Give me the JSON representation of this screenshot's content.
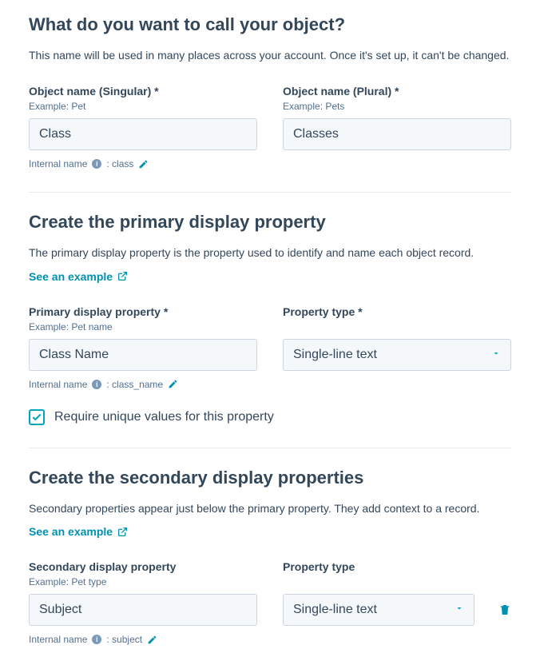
{
  "section1": {
    "title": "What do you want to call your object?",
    "desc": "This name will be used in many places across your account. Once it's set up, it can't be changed.",
    "singular": {
      "label": "Object name (Singular) *",
      "example": "Example: Pet",
      "value": "Class",
      "internal_label": "Internal name",
      "internal_value": ": class"
    },
    "plural": {
      "label": "Object name (Plural) *",
      "example": "Example: Pets",
      "value": "Classes"
    }
  },
  "section2": {
    "title": "Create the primary display property",
    "desc": "The primary display property is the property used to identify and name each object record.",
    "link": "See an example",
    "primary": {
      "label": "Primary display property *",
      "example": "Example: Pet name",
      "value": "Class Name",
      "internal_label": "Internal name",
      "internal_value": ": class_name"
    },
    "type": {
      "label": "Property type *",
      "value": "Single-line text"
    },
    "checkbox_label": "Require unique values for this property"
  },
  "section3": {
    "title": "Create the secondary display properties",
    "desc": "Secondary properties appear just below the primary property. They add context to a record.",
    "link": "See an example",
    "secondary": {
      "label": "Secondary display property",
      "example": "Example: Pet type",
      "value": "Subject",
      "internal_label": "Internal name",
      "internal_value": ": subject"
    },
    "type": {
      "label": "Property type",
      "value": "Single-line text"
    }
  }
}
